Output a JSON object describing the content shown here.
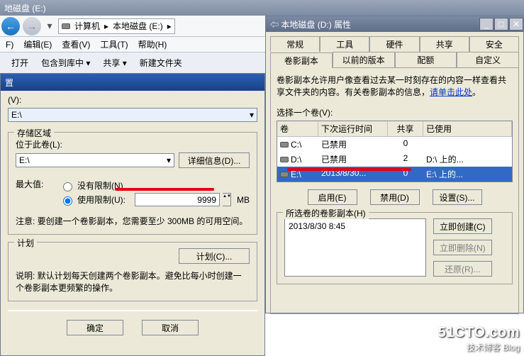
{
  "explorer": {
    "title": "地磁盘 (E:)",
    "breadcrumb": {
      "root": "计算机",
      "current": "本地磁盘 (E:)"
    },
    "menu": {
      "f": "F)",
      "edit": "编辑(E)",
      "view": "查看(V)",
      "tools": "工具(T)",
      "help": "帮助(H)"
    },
    "toolbar": {
      "open": "打开",
      "include": "包含到库中",
      "share": "共享",
      "newfolder": "新建文件夹"
    }
  },
  "settings": {
    "title": "置",
    "volume_label": "(V):",
    "volume_value": "E:\\",
    "storage": {
      "legend": "存储区域",
      "located_label": "位于此卷(L):",
      "located_value": "E:\\",
      "details_btn": "详细信息(D)...",
      "max_label": "最大值:",
      "no_limit": "没有限制(N)",
      "use_limit": "使用限制(U):",
      "limit_value": "9999",
      "unit": "MB",
      "note": "注意: 要创建一个卷影副本，您需要至少 300MB 的可用空间。"
    },
    "schedule": {
      "legend": "计划",
      "btn": "计划(C)..."
    },
    "desc": "说明: 默认计划每天创建两个卷影副本。避免比每小时创建一个卷影副本更频繁的操作。",
    "ok": "确定",
    "cancel": "取消"
  },
  "props": {
    "title": "本地磁盘 (D:) 属性",
    "tabs_top": {
      "general": "常规",
      "tools": "工具",
      "hardware": "硬件",
      "sharing": "共享",
      "security": "安全"
    },
    "tabs_bot": {
      "shadow": "卷影副本",
      "prev": "以前的版本",
      "quota": "配额",
      "custom": "自定义"
    },
    "desc": "卷影副本允许用户像查看过去某一时刻存在的内容一样查看共享文件夹的内容。有关卷影副本的信息，",
    "desc_link": "请单击此处",
    "select_label": "选择一个卷(V):",
    "cols": {
      "vol": "卷",
      "time": "下次运行时间",
      "shared": "共享",
      "used": "已使用"
    },
    "rows": [
      {
        "vol": "C:\\",
        "time": "已禁用",
        "shared": "0",
        "used": ""
      },
      {
        "vol": "D:\\",
        "time": "已禁用",
        "shared": "2",
        "used": "D:\\ 上的..."
      },
      {
        "vol": "E:\\",
        "time": "2013/8/30...",
        "shared": "0",
        "used": "E:\\ 上的..."
      }
    ],
    "enable_btn": "启用(E)",
    "disable_btn": "禁用(D)",
    "settings_btn": "设置(S)...",
    "selected_legend": "所选卷的卷影副本(H)",
    "copy_entry": "2013/8/30 8:45",
    "create_btn": "立即创建(C)",
    "delete_btn": "立即删除(N)",
    "restore_btn": "还原(R)..."
  },
  "watermark": {
    "big": "51CTO.com",
    "sm": "技术博客 Blog"
  }
}
